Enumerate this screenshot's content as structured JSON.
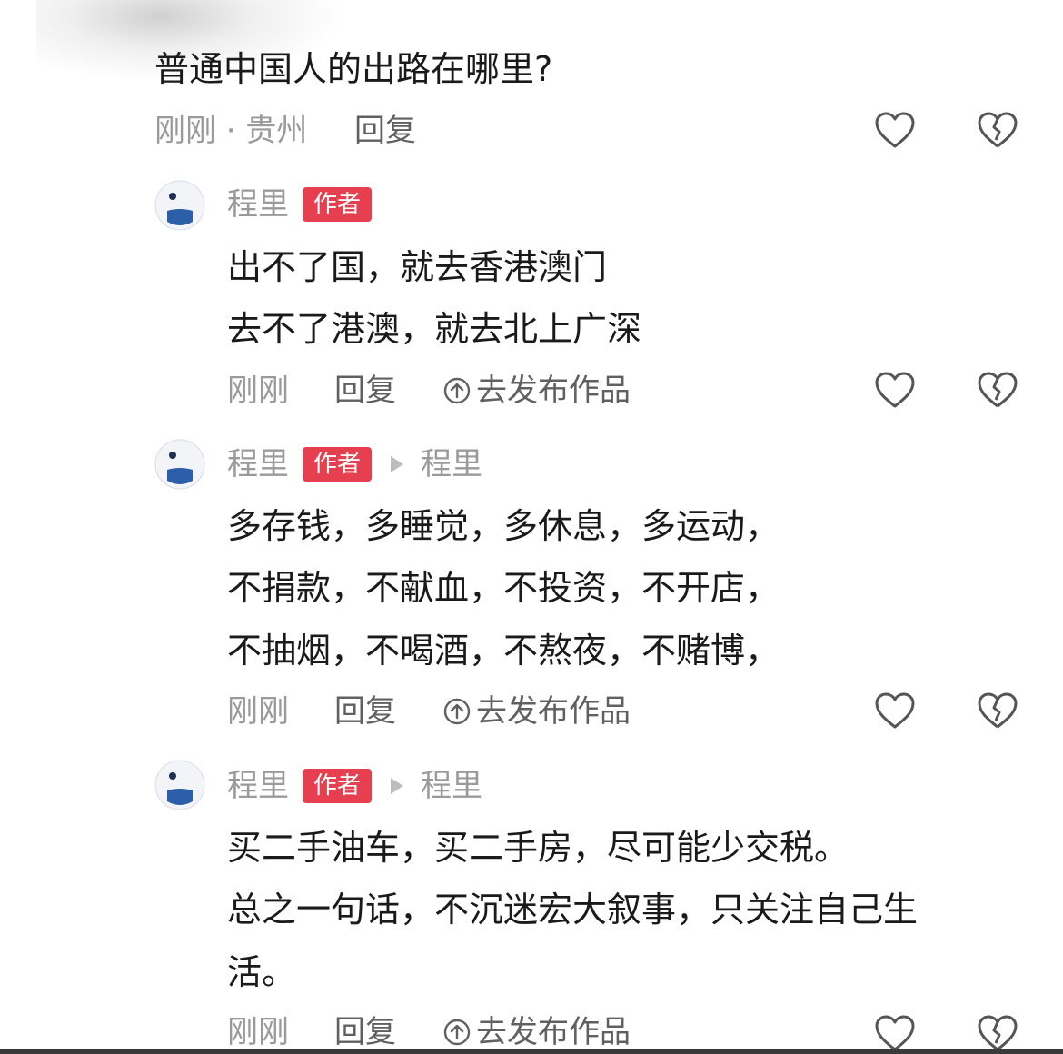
{
  "question": {
    "text": "普通中国人的出路在哪里?",
    "meta": "刚刚 · 贵州",
    "reply": "回复"
  },
  "comments": [
    {
      "name": "程里",
      "badge": "作者",
      "reply_to": "",
      "lines": [
        "出不了国，就去香港澳门",
        "去不了港澳，就去北上广深"
      ],
      "time": "刚刚",
      "reply": "回复",
      "publish": "去发布作品"
    },
    {
      "name": "程里",
      "badge": "作者",
      "reply_to": "程里",
      "lines": [
        "多存钱，多睡觉，多休息，多运动，",
        "不捐款，不献血，不投资，不开店，",
        "不抽烟，不喝酒，不熬夜，不赌博，"
      ],
      "time": "刚刚",
      "reply": "回复",
      "publish": "去发布作品"
    },
    {
      "name": "程里",
      "badge": "作者",
      "reply_to": "程里",
      "lines": [
        "买二手油车，买二手房，尽可能少交税。",
        "总之一句话，不沉迷宏大叙事，只关注自己生",
        "活。"
      ],
      "time": "刚刚",
      "reply": "回复",
      "publish": "去发布作品"
    }
  ],
  "icons": {
    "like": "heart-outline-icon",
    "dislike": "broken-heart-icon",
    "publish": "circle-up-arrow-icon"
  },
  "colors": {
    "badge": "#e64050",
    "text": "#1a1a1a",
    "meta": "#9a9a9a",
    "icon": "#555555"
  }
}
